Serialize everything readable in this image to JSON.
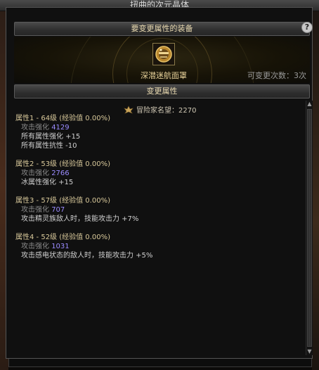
{
  "window": {
    "title": "扭曲的次元晶体"
  },
  "equipment_section": {
    "header": "要变更属性的装备",
    "help_icon": "?",
    "item_name": "深潜迷航面罩",
    "remaining_changes": "可变更次数：3次"
  },
  "change_section": {
    "header": "变更属性",
    "fame_label": "冒险家名望：2270"
  },
  "attributes": [
    {
      "header": "属性1 - 64级 (经验值 0.00%)",
      "lines": [
        {
          "key": "攻击强化",
          "value": "4129"
        },
        {
          "text": "所有属性强化 +15"
        },
        {
          "text": "所有属性抗性 -10"
        }
      ]
    },
    {
      "header": "属性2 - 53级 (经验值 0.00%)",
      "lines": [
        {
          "key": "攻击强化",
          "value": "2766"
        },
        {
          "text": "冰属性强化 +15"
        }
      ]
    },
    {
      "header": "属性3 - 57级 (经验值 0.00%)",
      "lines": [
        {
          "key": "攻击强化",
          "value": "707"
        },
        {
          "text": "攻击精灵族敌人时，技能攻击力 +7%"
        }
      ]
    },
    {
      "header": "属性4 - 52级 (经验值 0.00%)",
      "lines": [
        {
          "key": "攻击强化",
          "value": "1031"
        },
        {
          "text": "攻击感电状态的敌人时，技能攻击力 +5%"
        }
      ]
    }
  ]
}
